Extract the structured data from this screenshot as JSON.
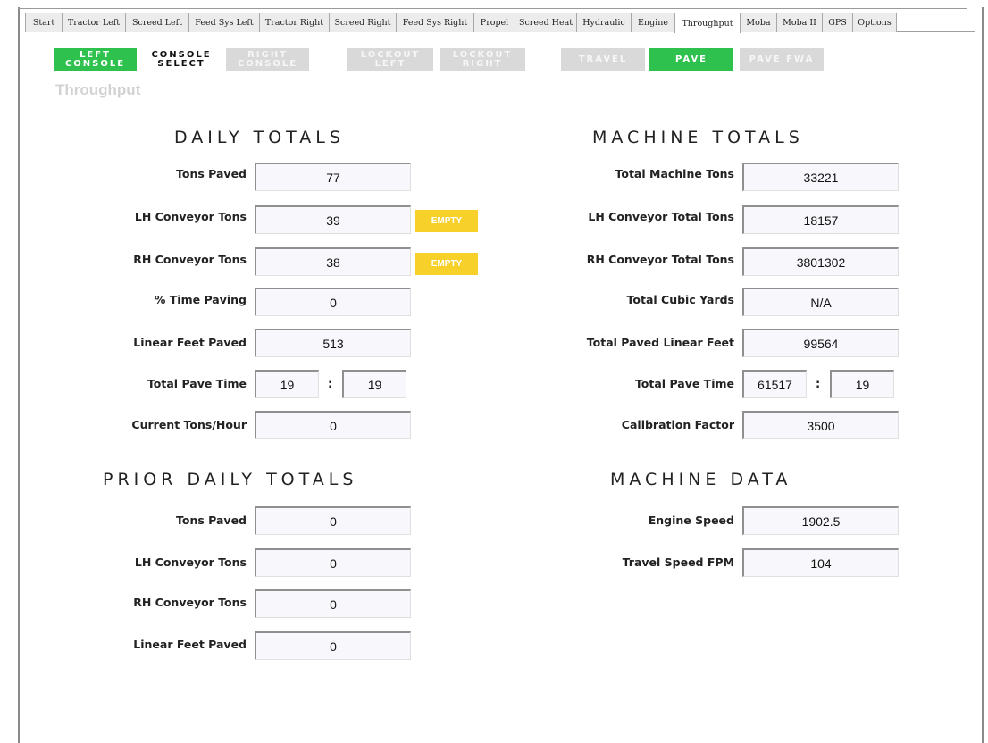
{
  "tabs": [
    {
      "label": "Start",
      "width": 42
    },
    {
      "label": "Tractor Left",
      "width": 72
    },
    {
      "label": "Screed Left",
      "width": 72
    },
    {
      "label": "Feed Sys Left",
      "width": 80
    },
    {
      "label": "Tractor Right",
      "width": 79
    },
    {
      "label": "Screed Right",
      "width": 76
    },
    {
      "label": "Feed Sys Right",
      "width": 88
    },
    {
      "label": "Propel",
      "width": 47
    },
    {
      "label": "Screed Heat",
      "width": 70
    },
    {
      "label": "Hydraulic",
      "width": 62
    },
    {
      "label": "Engine",
      "width": 50
    },
    {
      "label": "Throughput",
      "width": 74
    },
    {
      "label": "Moba",
      "width": 42
    },
    {
      "label": "Moba II",
      "width": 52
    },
    {
      "label": "GPS",
      "width": 35
    },
    {
      "label": "Options",
      "width": 50
    }
  ],
  "active_tab": "Throughput",
  "controls": {
    "left_console": [
      "LEFT",
      "CONSOLE"
    ],
    "console_select": [
      "CONSOLE",
      "SELECT"
    ],
    "right_console": [
      "RIGHT",
      "CONSOLE"
    ],
    "lockout_left": [
      "LOCKOUT",
      "LEFT"
    ],
    "lockout_right": [
      "LOCKOUT",
      "RIGHT"
    ],
    "travel": "TRAVEL",
    "pave": "PAVE",
    "pave_fwa": "PAVE FWA"
  },
  "page_title": "Throughput",
  "daily_totals": {
    "title": "DAILY TOTALS",
    "tons_paved": {
      "label": "Tons Paved",
      "value": "77"
    },
    "lh_conveyor_tons": {
      "label": "LH Conveyor Tons",
      "value": "39",
      "button": "EMPTY"
    },
    "rh_conveyor_tons": {
      "label": "RH Conveyor Tons",
      "value": "38",
      "button": "EMPTY"
    },
    "pct_time_paving": {
      "label": "% Time Paving",
      "value": "0"
    },
    "linear_feet_paved": {
      "label": "Linear Feet Paved",
      "value": "513"
    },
    "total_pave_time": {
      "label": "Total Pave Time",
      "hours": "19",
      "minutes": "19",
      "separator": ":"
    },
    "current_tons_hour": {
      "label": "Current Tons/Hour",
      "value": "0"
    }
  },
  "prior_daily_totals": {
    "title": "PRIOR DAILY TOTALS",
    "tons_paved": {
      "label": "Tons Paved",
      "value": "0"
    },
    "lh_conveyor_tons": {
      "label": "LH Conveyor Tons",
      "value": "0"
    },
    "rh_conveyor_tons": {
      "label": "RH Conveyor Tons",
      "value": "0"
    },
    "linear_feet_paved": {
      "label": "Linear Feet Paved",
      "value": "0"
    }
  },
  "machine_totals": {
    "title": "MACHINE TOTALS",
    "total_machine_tons": {
      "label": "Total Machine Tons",
      "value": "33221"
    },
    "lh_conveyor_total_tons": {
      "label": "LH Conveyor Total Tons",
      "value": "18157"
    },
    "rh_conveyor_total_tons": {
      "label": "RH Conveyor Total Tons",
      "value": "3801302"
    },
    "total_cubic_yards": {
      "label": "Total Cubic Yards",
      "value": "N/A"
    },
    "total_paved_linear_feet": {
      "label": "Total Paved Linear Feet",
      "value": "99564"
    },
    "total_pave_time": {
      "label": "Total Pave Time",
      "hours": "61517",
      "minutes": "19",
      "separator": ":"
    },
    "calibration_factor": {
      "label": "Calibration Factor",
      "value": "3500"
    }
  },
  "machine_data": {
    "title": "MACHINE DATA",
    "engine_speed": {
      "label": "Engine Speed",
      "value": "1902.5"
    },
    "travel_speed_fpm": {
      "label": "Travel Speed FPM",
      "value": "104"
    }
  },
  "colors": {
    "active_green": "#2fc14e",
    "inactive_gray": "#d9d9d9",
    "empty_yellow": "#f7d02a"
  }
}
